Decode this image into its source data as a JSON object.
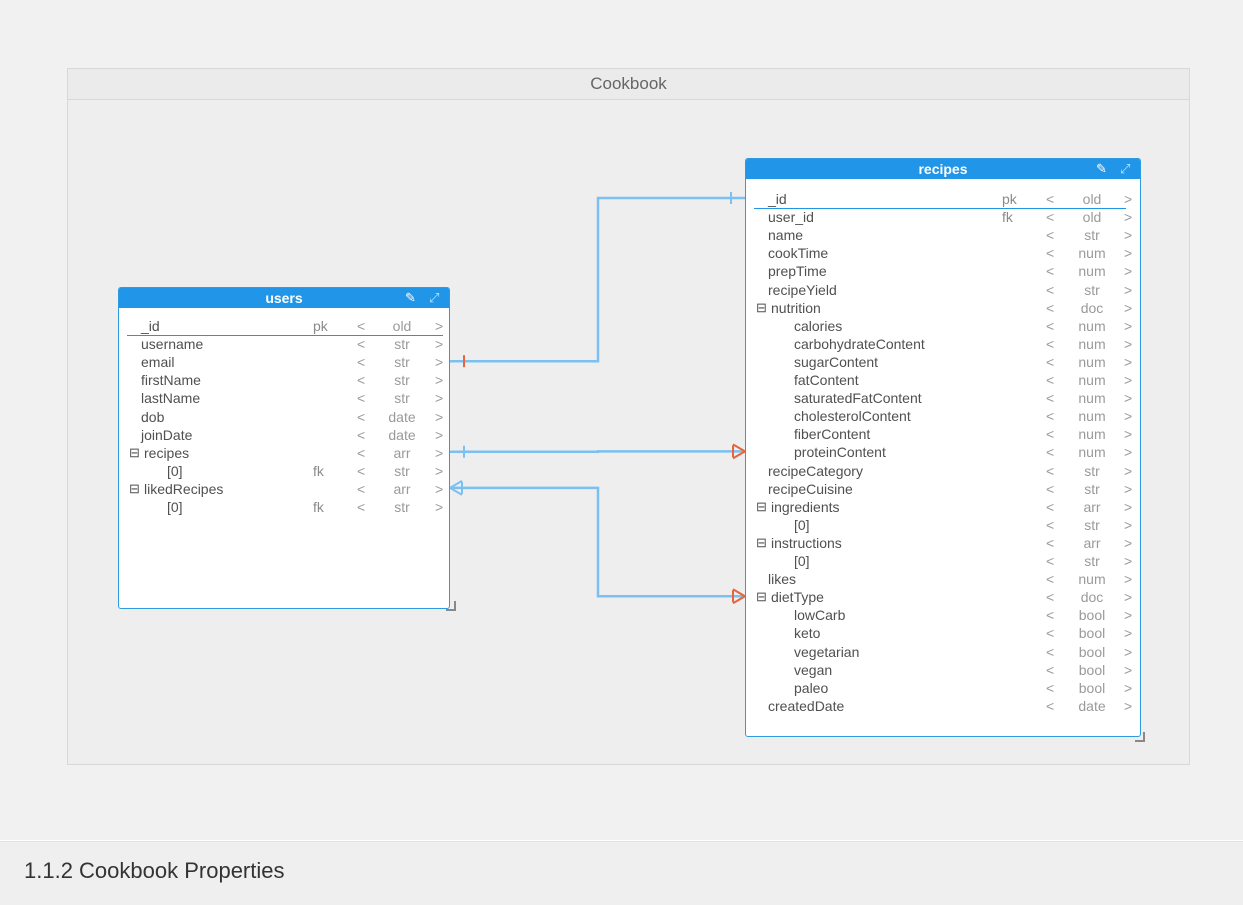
{
  "diagram": {
    "title": "Cookbook",
    "tables": [
      {
        "id": "users",
        "name": "users",
        "fields": [
          {
            "name": "_id",
            "key": "pk",
            "type": "old",
            "indent": 0,
            "toggle": false
          },
          {
            "name": "username",
            "key": "",
            "type": "str",
            "indent": 0,
            "toggle": false
          },
          {
            "name": "email",
            "key": "",
            "type": "str",
            "indent": 0,
            "toggle": false
          },
          {
            "name": "firstName",
            "key": "",
            "type": "str",
            "indent": 0,
            "toggle": false
          },
          {
            "name": "lastName",
            "key": "",
            "type": "str",
            "indent": 0,
            "toggle": false
          },
          {
            "name": "dob",
            "key": "",
            "type": "date",
            "indent": 0,
            "toggle": false
          },
          {
            "name": "joinDate",
            "key": "",
            "type": "date",
            "indent": 0,
            "toggle": false
          },
          {
            "name": "recipes",
            "key": "",
            "type": "arr",
            "indent": 0,
            "toggle": true
          },
          {
            "name": "[0]",
            "key": "fk",
            "type": "str",
            "indent": 1,
            "toggle": false
          },
          {
            "name": "likedRecipes",
            "key": "",
            "type": "arr",
            "indent": 0,
            "toggle": true
          },
          {
            "name": "[0]",
            "key": "fk",
            "type": "str",
            "indent": 1,
            "toggle": false
          }
        ]
      },
      {
        "id": "recipes",
        "name": "recipes",
        "fields": [
          {
            "name": "_id",
            "key": "pk",
            "type": "old",
            "indent": 0,
            "toggle": false
          },
          {
            "name": "user_id",
            "key": "fk",
            "type": "old",
            "indent": 0,
            "toggle": false
          },
          {
            "name": "name",
            "key": "",
            "type": "str",
            "indent": 0,
            "toggle": false
          },
          {
            "name": "cookTime",
            "key": "",
            "type": "num",
            "indent": 0,
            "toggle": false
          },
          {
            "name": "prepTime",
            "key": "",
            "type": "num",
            "indent": 0,
            "toggle": false
          },
          {
            "name": "recipeYield",
            "key": "",
            "type": "str",
            "indent": 0,
            "toggle": false
          },
          {
            "name": "nutrition",
            "key": "",
            "type": "doc",
            "indent": 0,
            "toggle": true
          },
          {
            "name": "calories",
            "key": "",
            "type": "num",
            "indent": 1,
            "toggle": false
          },
          {
            "name": "carbohydrateContent",
            "key": "",
            "type": "num",
            "indent": 1,
            "toggle": false
          },
          {
            "name": "sugarContent",
            "key": "",
            "type": "num",
            "indent": 1,
            "toggle": false
          },
          {
            "name": "fatContent",
            "key": "",
            "type": "num",
            "indent": 1,
            "toggle": false
          },
          {
            "name": "saturatedFatContent",
            "key": "",
            "type": "num",
            "indent": 1,
            "toggle": false
          },
          {
            "name": "cholesterolContent",
            "key": "",
            "type": "num",
            "indent": 1,
            "toggle": false
          },
          {
            "name": "fiberContent",
            "key": "",
            "type": "num",
            "indent": 1,
            "toggle": false
          },
          {
            "name": "proteinContent",
            "key": "",
            "type": "num",
            "indent": 1,
            "toggle": false
          },
          {
            "name": "recipeCategory",
            "key": "",
            "type": "str",
            "indent": 0,
            "toggle": false
          },
          {
            "name": "recipeCuisine",
            "key": "",
            "type": "str",
            "indent": 0,
            "toggle": false
          },
          {
            "name": "ingredients",
            "key": "",
            "type": "arr",
            "indent": 0,
            "toggle": true
          },
          {
            "name": "[0]",
            "key": "",
            "type": "str",
            "indent": 1,
            "toggle": false
          },
          {
            "name": "instructions",
            "key": "",
            "type": "arr",
            "indent": 0,
            "toggle": true
          },
          {
            "name": "[0]",
            "key": "",
            "type": "str",
            "indent": 1,
            "toggle": false
          },
          {
            "name": "likes",
            "key": "",
            "type": "num",
            "indent": 0,
            "toggle": false
          },
          {
            "name": "dietType",
            "key": "",
            "type": "doc",
            "indent": 0,
            "toggle": true
          },
          {
            "name": "lowCarb",
            "key": "",
            "type": "bool",
            "indent": 1,
            "toggle": false
          },
          {
            "name": "keto",
            "key": "",
            "type": "bool",
            "indent": 1,
            "toggle": false
          },
          {
            "name": "vegetarian",
            "key": "",
            "type": "bool",
            "indent": 1,
            "toggle": false
          },
          {
            "name": "vegan",
            "key": "",
            "type": "bool",
            "indent": 1,
            "toggle": false
          },
          {
            "name": "paleo",
            "key": "",
            "type": "bool",
            "indent": 1,
            "toggle": false
          },
          {
            "name": "createdDate",
            "key": "",
            "type": "date",
            "indent": 0,
            "toggle": false
          }
        ]
      }
    ],
    "relationships": [
      {
        "from": "recipes._id",
        "to": "users.email",
        "from_end": "one",
        "to_end": "one"
      },
      {
        "from": "users.recipes",
        "to": "recipes.proteinContent",
        "from_end": "one",
        "to_end": "many"
      },
      {
        "from": "users.likedRecipes",
        "to": "recipes.dietType",
        "from_end": "many",
        "to_end": "many"
      }
    ],
    "colors": {
      "header": "#2196e8",
      "line": "#7cc0f2",
      "crow_foot": "#e8643a"
    },
    "icons": {
      "edit": "pencil-icon",
      "expand": "expand-icon",
      "toggle": "collapse-toggle-icon"
    }
  },
  "section": {
    "title": "1.1.2 Cookbook Properties"
  }
}
